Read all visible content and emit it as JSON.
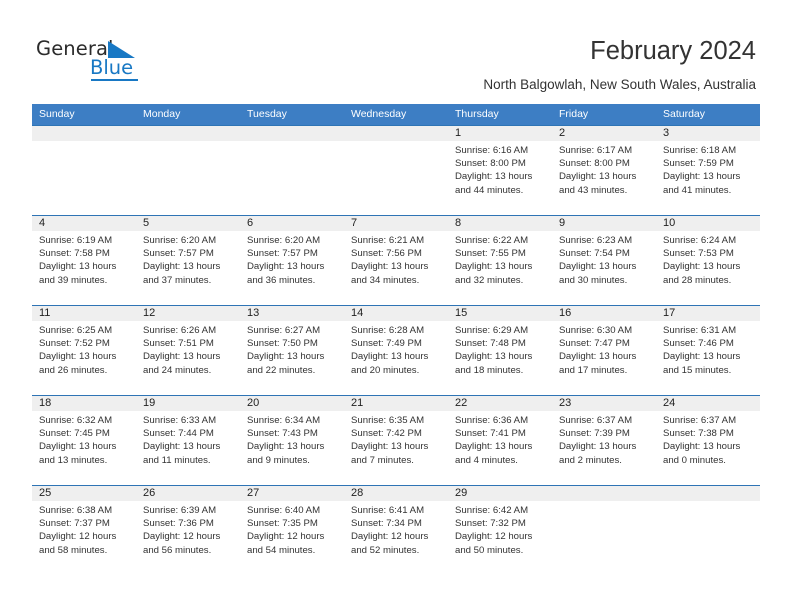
{
  "brand": {
    "word_general": "General",
    "word_blue": "Blue",
    "triangle_icon": "triangle-icon",
    "accent_color": "#1878c4"
  },
  "header": {
    "title": "February 2024",
    "location": "North Balgowlah, New South Wales, Australia"
  },
  "theme": {
    "header_blue": "#3d7ec4",
    "row_divider_blue": "#2e74b5",
    "day_number_band": "#efefef"
  },
  "calendar": {
    "weekday_headers": [
      "Sunday",
      "Monday",
      "Tuesday",
      "Wednesday",
      "Thursday",
      "Friday",
      "Saturday"
    ],
    "weeks": [
      {
        "days": [
          {
            "number": "",
            "sunrise": "",
            "sunset": "",
            "daylight_line1": "",
            "daylight_line2": ""
          },
          {
            "number": "",
            "sunrise": "",
            "sunset": "",
            "daylight_line1": "",
            "daylight_line2": ""
          },
          {
            "number": "",
            "sunrise": "",
            "sunset": "",
            "daylight_line1": "",
            "daylight_line2": ""
          },
          {
            "number": "",
            "sunrise": "",
            "sunset": "",
            "daylight_line1": "",
            "daylight_line2": ""
          },
          {
            "number": "1",
            "sunrise": "Sunrise: 6:16 AM",
            "sunset": "Sunset: 8:00 PM",
            "daylight_line1": "Daylight: 13 hours",
            "daylight_line2": "and 44 minutes."
          },
          {
            "number": "2",
            "sunrise": "Sunrise: 6:17 AM",
            "sunset": "Sunset: 8:00 PM",
            "daylight_line1": "Daylight: 13 hours",
            "daylight_line2": "and 43 minutes."
          },
          {
            "number": "3",
            "sunrise": "Sunrise: 6:18 AM",
            "sunset": "Sunset: 7:59 PM",
            "daylight_line1": "Daylight: 13 hours",
            "daylight_line2": "and 41 minutes."
          }
        ]
      },
      {
        "days": [
          {
            "number": "4",
            "sunrise": "Sunrise: 6:19 AM",
            "sunset": "Sunset: 7:58 PM",
            "daylight_line1": "Daylight: 13 hours",
            "daylight_line2": "and 39 minutes."
          },
          {
            "number": "5",
            "sunrise": "Sunrise: 6:20 AM",
            "sunset": "Sunset: 7:57 PM",
            "daylight_line1": "Daylight: 13 hours",
            "daylight_line2": "and 37 minutes."
          },
          {
            "number": "6",
            "sunrise": "Sunrise: 6:20 AM",
            "sunset": "Sunset: 7:57 PM",
            "daylight_line1": "Daylight: 13 hours",
            "daylight_line2": "and 36 minutes."
          },
          {
            "number": "7",
            "sunrise": "Sunrise: 6:21 AM",
            "sunset": "Sunset: 7:56 PM",
            "daylight_line1": "Daylight: 13 hours",
            "daylight_line2": "and 34 minutes."
          },
          {
            "number": "8",
            "sunrise": "Sunrise: 6:22 AM",
            "sunset": "Sunset: 7:55 PM",
            "daylight_line1": "Daylight: 13 hours",
            "daylight_line2": "and 32 minutes."
          },
          {
            "number": "9",
            "sunrise": "Sunrise: 6:23 AM",
            "sunset": "Sunset: 7:54 PM",
            "daylight_line1": "Daylight: 13 hours",
            "daylight_line2": "and 30 minutes."
          },
          {
            "number": "10",
            "sunrise": "Sunrise: 6:24 AM",
            "sunset": "Sunset: 7:53 PM",
            "daylight_line1": "Daylight: 13 hours",
            "daylight_line2": "and 28 minutes."
          }
        ]
      },
      {
        "days": [
          {
            "number": "11",
            "sunrise": "Sunrise: 6:25 AM",
            "sunset": "Sunset: 7:52 PM",
            "daylight_line1": "Daylight: 13 hours",
            "daylight_line2": "and 26 minutes."
          },
          {
            "number": "12",
            "sunrise": "Sunrise: 6:26 AM",
            "sunset": "Sunset: 7:51 PM",
            "daylight_line1": "Daylight: 13 hours",
            "daylight_line2": "and 24 minutes."
          },
          {
            "number": "13",
            "sunrise": "Sunrise: 6:27 AM",
            "sunset": "Sunset: 7:50 PM",
            "daylight_line1": "Daylight: 13 hours",
            "daylight_line2": "and 22 minutes."
          },
          {
            "number": "14",
            "sunrise": "Sunrise: 6:28 AM",
            "sunset": "Sunset: 7:49 PM",
            "daylight_line1": "Daylight: 13 hours",
            "daylight_line2": "and 20 minutes."
          },
          {
            "number": "15",
            "sunrise": "Sunrise: 6:29 AM",
            "sunset": "Sunset: 7:48 PM",
            "daylight_line1": "Daylight: 13 hours",
            "daylight_line2": "and 18 minutes."
          },
          {
            "number": "16",
            "sunrise": "Sunrise: 6:30 AM",
            "sunset": "Sunset: 7:47 PM",
            "daylight_line1": "Daylight: 13 hours",
            "daylight_line2": "and 17 minutes."
          },
          {
            "number": "17",
            "sunrise": "Sunrise: 6:31 AM",
            "sunset": "Sunset: 7:46 PM",
            "daylight_line1": "Daylight: 13 hours",
            "daylight_line2": "and 15 minutes."
          }
        ]
      },
      {
        "days": [
          {
            "number": "18",
            "sunrise": "Sunrise: 6:32 AM",
            "sunset": "Sunset: 7:45 PM",
            "daylight_line1": "Daylight: 13 hours",
            "daylight_line2": "and 13 minutes."
          },
          {
            "number": "19",
            "sunrise": "Sunrise: 6:33 AM",
            "sunset": "Sunset: 7:44 PM",
            "daylight_line1": "Daylight: 13 hours",
            "daylight_line2": "and 11 minutes."
          },
          {
            "number": "20",
            "sunrise": "Sunrise: 6:34 AM",
            "sunset": "Sunset: 7:43 PM",
            "daylight_line1": "Daylight: 13 hours",
            "daylight_line2": "and 9 minutes."
          },
          {
            "number": "21",
            "sunrise": "Sunrise: 6:35 AM",
            "sunset": "Sunset: 7:42 PM",
            "daylight_line1": "Daylight: 13 hours",
            "daylight_line2": "and 7 minutes."
          },
          {
            "number": "22",
            "sunrise": "Sunrise: 6:36 AM",
            "sunset": "Sunset: 7:41 PM",
            "daylight_line1": "Daylight: 13 hours",
            "daylight_line2": "and 4 minutes."
          },
          {
            "number": "23",
            "sunrise": "Sunrise: 6:37 AM",
            "sunset": "Sunset: 7:39 PM",
            "daylight_line1": "Daylight: 13 hours",
            "daylight_line2": "and 2 minutes."
          },
          {
            "number": "24",
            "sunrise": "Sunrise: 6:37 AM",
            "sunset": "Sunset: 7:38 PM",
            "daylight_line1": "Daylight: 13 hours",
            "daylight_line2": "and 0 minutes."
          }
        ]
      },
      {
        "days": [
          {
            "number": "25",
            "sunrise": "Sunrise: 6:38 AM",
            "sunset": "Sunset: 7:37 PM",
            "daylight_line1": "Daylight: 12 hours",
            "daylight_line2": "and 58 minutes."
          },
          {
            "number": "26",
            "sunrise": "Sunrise: 6:39 AM",
            "sunset": "Sunset: 7:36 PM",
            "daylight_line1": "Daylight: 12 hours",
            "daylight_line2": "and 56 minutes."
          },
          {
            "number": "27",
            "sunrise": "Sunrise: 6:40 AM",
            "sunset": "Sunset: 7:35 PM",
            "daylight_line1": "Daylight: 12 hours",
            "daylight_line2": "and 54 minutes."
          },
          {
            "number": "28",
            "sunrise": "Sunrise: 6:41 AM",
            "sunset": "Sunset: 7:34 PM",
            "daylight_line1": "Daylight: 12 hours",
            "daylight_line2": "and 52 minutes."
          },
          {
            "number": "29",
            "sunrise": "Sunrise: 6:42 AM",
            "sunset": "Sunset: 7:32 PM",
            "daylight_line1": "Daylight: 12 hours",
            "daylight_line2": "and 50 minutes."
          },
          {
            "number": "",
            "sunrise": "",
            "sunset": "",
            "daylight_line1": "",
            "daylight_line2": ""
          },
          {
            "number": "",
            "sunrise": "",
            "sunset": "",
            "daylight_line1": "",
            "daylight_line2": ""
          }
        ]
      }
    ]
  }
}
